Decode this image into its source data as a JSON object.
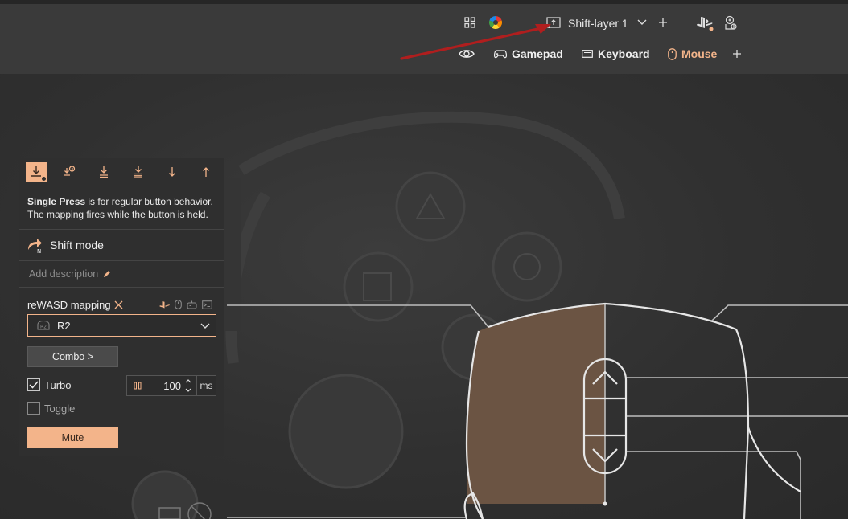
{
  "header": {
    "layer_label": "Shift-layer 1",
    "tabs": [
      {
        "label": "Gamepad",
        "icon": "gamepad-icon"
      },
      {
        "label": "Keyboard",
        "icon": "keyboard-icon"
      },
      {
        "label": "Mouse",
        "icon": "mouse-icon",
        "active": true
      }
    ]
  },
  "panel": {
    "description_bold": "Single Press",
    "description_rest": " is for regular button behavior. The mapping fires while the button is held.",
    "shift_mode_label": "Shift mode",
    "add_description_label": "Add description",
    "mapping_label": "reWASD mapping",
    "selected_mapping": "R2",
    "combo_label": "Combo >",
    "turbo_label": "Turbo",
    "turbo_checked": true,
    "turbo_value": "100",
    "turbo_unit": "ms",
    "toggle_label": "Toggle",
    "toggle_checked": false,
    "mute_label": "Mute"
  },
  "colors": {
    "accent": "#f3b48a",
    "highlight_zone": "#6b5443",
    "annotation_arrow": "#b01e1e"
  }
}
